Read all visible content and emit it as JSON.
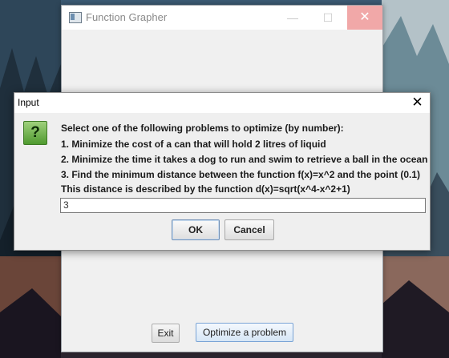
{
  "background_window": {
    "title": "Function Grapher",
    "controls": {
      "minimize": "—",
      "maximize": "☐",
      "close": "✕"
    },
    "buttons": {
      "exit": "Exit",
      "optimize": "Optimize a problem"
    }
  },
  "dialog": {
    "title": "Input",
    "close": "✕",
    "icon": "question-icon",
    "icon_glyph": "?",
    "message_lines": [
      "Select one of the following problems to optimize (by number):",
      "1. Minimize the cost of a can that will hold 2 litres of liquid",
      "2. Minimize the time it takes a dog to run and swim to retrieve a ball in the ocean",
      "3. Find the minimum distance between the function f(x)=x^2 and the point (0.1)",
      " This distance is described by the function d(x)=sqrt(x^4-x^2+1)"
    ],
    "input_value": "3",
    "ok_label": "OK",
    "cancel_label": "Cancel"
  },
  "colors": {
    "close_hover": "#f1a8a8",
    "icon_green": "#4f9a2f",
    "ok_border": "#6f8fb5"
  }
}
